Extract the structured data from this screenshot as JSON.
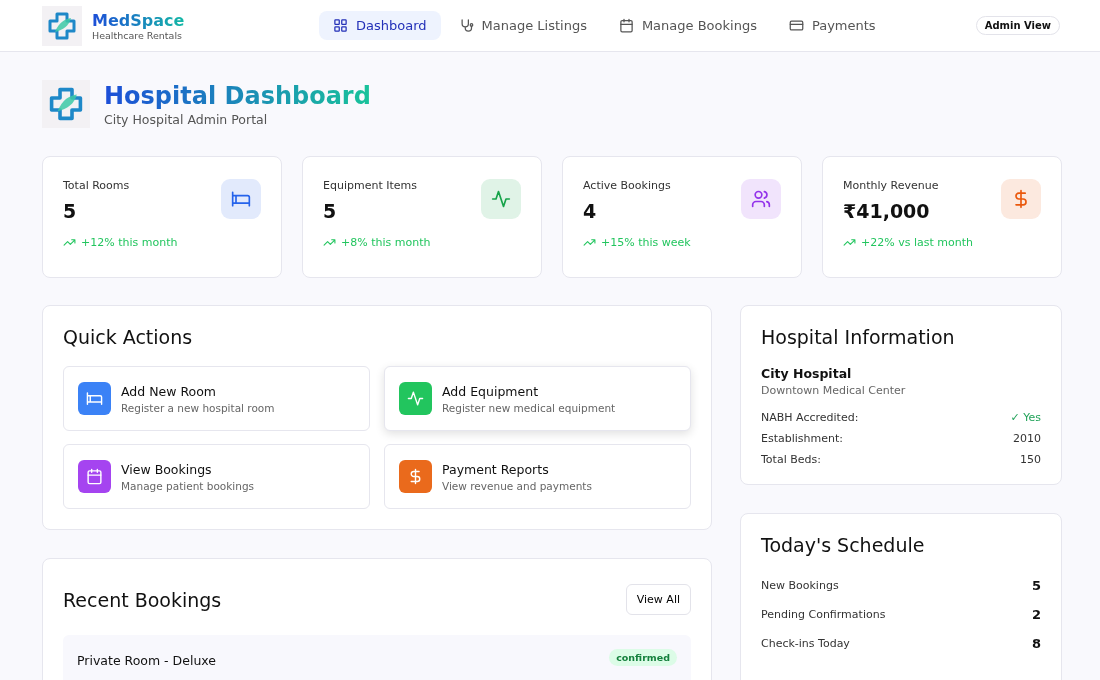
{
  "brand": {
    "name": "MedSpace",
    "tagline": "Healthcare Rentals"
  },
  "nav": [
    {
      "label": "Dashboard",
      "kind": "grid",
      "selected": true
    },
    {
      "label": "Manage Listings",
      "kind": "stethoscope",
      "selected": false
    },
    {
      "label": "Manage Bookings",
      "kind": "calendar",
      "selected": false
    },
    {
      "label": "Payments",
      "kind": "card",
      "selected": false
    }
  ],
  "role_badge": "Admin View",
  "page": {
    "title": "Hospital Dashboard",
    "subtitle": "City Hospital Admin Portal"
  },
  "stats": [
    {
      "label": "Total Rooms",
      "value": "5",
      "trend": "+12% this month",
      "kind": "bed",
      "color": "#2563eb"
    },
    {
      "label": "Equipment Items",
      "value": "5",
      "trend": "+8% this month",
      "kind": "activity",
      "color": "#16a34a"
    },
    {
      "label": "Active Bookings",
      "value": "4",
      "trend": "+15% this week",
      "kind": "users",
      "color": "#9333ea"
    },
    {
      "label": "Monthly Revenue",
      "value": "₹41,000",
      "trend": "+22% vs last month",
      "kind": "dollar",
      "color": "#ea580c"
    }
  ],
  "quick_actions": {
    "title": "Quick Actions",
    "items": [
      {
        "title": "Add New Room",
        "description": "Register a new hospital room",
        "kind": "bed",
        "color": "#3b82f6",
        "highlighted": false
      },
      {
        "title": "Add Equipment",
        "description": "Register new medical equipment",
        "kind": "activity",
        "color": "#22c55e",
        "highlighted": true
      },
      {
        "title": "View Bookings",
        "description": "Manage patient bookings",
        "kind": "calendar",
        "color": "#a544f0",
        "highlighted": false
      },
      {
        "title": "Payment Reports",
        "description": "View revenue and payments",
        "kind": "dollar",
        "color": "#ea6a1c",
        "highlighted": false
      }
    ]
  },
  "recent_bookings": {
    "title": "Recent Bookings",
    "action": "View All",
    "rows": [
      {
        "title": "Private Room - Deluxe",
        "status": "confirmed"
      }
    ]
  },
  "hospital_info": {
    "title": "Hospital Information",
    "name": "City Hospital",
    "location": "Downtown Medical Center",
    "rows": [
      {
        "label": "NABH Accredited:",
        "value": "✓ Yes",
        "kind": "positive"
      },
      {
        "label": "Establishment:",
        "value": "2010",
        "kind": "plain"
      },
      {
        "label": "Total Beds:",
        "value": "150",
        "kind": "plain"
      }
    ]
  },
  "schedule": {
    "title": "Today's Schedule",
    "rows": [
      {
        "label": "New Bookings",
        "value": "5"
      },
      {
        "label": "Pending Confirmations",
        "value": "2"
      },
      {
        "label": "Check-ins Today",
        "value": "8"
      }
    ]
  }
}
